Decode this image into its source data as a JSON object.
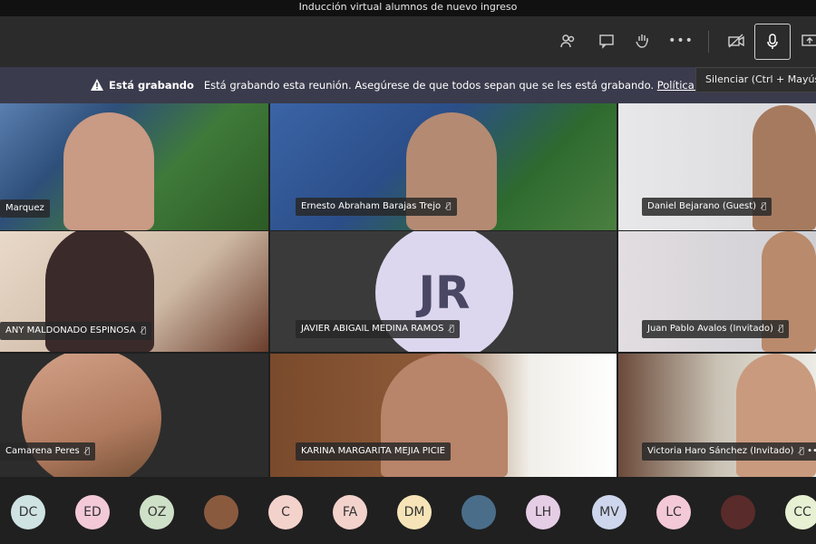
{
  "window": {
    "title": "Inducción virtual alumnos de nuevo ingreso"
  },
  "toolbar": {
    "buttons": [
      {
        "name": "participants-icon",
        "symbol": "👥"
      },
      {
        "name": "chat-icon",
        "symbol": "💬"
      },
      {
        "name": "raise-hand-icon",
        "symbol": "✋"
      },
      {
        "name": "more-options-icon",
        "symbol": "•••"
      },
      {
        "name": "camera-off-icon",
        "symbol": "📷"
      },
      {
        "name": "microphone-icon",
        "symbol": "🎤"
      },
      {
        "name": "share-screen-icon",
        "symbol": "⇪"
      }
    ],
    "tooltip": "Silenciar (Ctrl + Mayús"
  },
  "banner": {
    "bold": "Está grabando",
    "message": "Está grabando esta reunión. Asegúrese de que todos sepan que se les está grabando.",
    "link": "Política de privacidad"
  },
  "participants": [
    {
      "name": "Marquez"
    },
    {
      "name": "Ernesto Abraham Barajas Trejo"
    },
    {
      "name": "Daniel Bejarano (Guest)"
    },
    {
      "name": "ANY MALDONADO ESPINOSA"
    },
    {
      "name": "JAVIER ABIGAIL MEDINA RAMOS",
      "initials": "JR"
    },
    {
      "name": "Juan Pablo Avalos (Invitado)"
    },
    {
      "name": "Camarena Peres"
    },
    {
      "name": "KARINA MARGARITA MEJIA PICIE"
    },
    {
      "name": "Victoria Haro Sánchez (Invitado)"
    }
  ],
  "tile_more": "•••",
  "bottom_avatars": [
    {
      "initials": "DC",
      "color": "#cfe3e3"
    },
    {
      "initials": "ED",
      "color": "#f3c9d8"
    },
    {
      "initials": "OZ",
      "color": "#cfe0c8"
    },
    {
      "initials": "",
      "color": "#8a5a3f"
    },
    {
      "initials": "C",
      "color": "#f4d2cc"
    },
    {
      "initials": "FA",
      "color": "#f4d2cc"
    },
    {
      "initials": "DM",
      "color": "#f6e4b8"
    },
    {
      "initials": "",
      "color": "#4a6e8a"
    },
    {
      "initials": "LH",
      "color": "#e6cde6"
    },
    {
      "initials": "MV",
      "color": "#cdd6ec"
    },
    {
      "initials": "LC",
      "color": "#f3c9d8"
    },
    {
      "initials": "",
      "color": "#5a2b2b"
    },
    {
      "initials": "CC",
      "color": "#e7f0d3"
    }
  ]
}
